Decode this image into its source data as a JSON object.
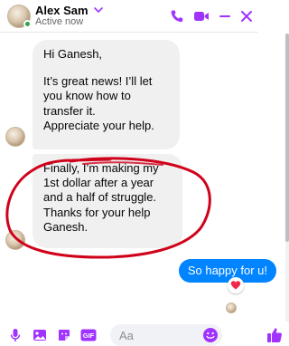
{
  "header": {
    "contact_name": "Alex Sam",
    "status": "Active now",
    "icons": [
      "phone-icon",
      "video-icon",
      "minimize-icon",
      "close-icon"
    ],
    "accent_color": "#a033ff"
  },
  "messages": [
    {
      "direction": "incoming",
      "lines": [
        "Hi Ganesh,",
        "",
        "It’s great news! I’ll let",
        "you know how to",
        "transfer it.",
        "Appreciate your help."
      ]
    },
    {
      "direction": "incoming",
      "lines": [
        "Finally, I’m making my",
        "1st dollar after a year",
        "and a half of struggle.",
        "Thanks for your help",
        "Ganesh."
      ],
      "annotation": "red-circle"
    },
    {
      "direction": "outgoing",
      "text": "So happy for u!",
      "reaction": "heart"
    }
  ],
  "composer": {
    "placeholder": "Aa",
    "tools": [
      "microphone-icon",
      "image-icon",
      "sticker-icon",
      "gif-icon"
    ],
    "like_icon": "thumbs-up-icon"
  },
  "colors": {
    "outgoing_bubble": "#0084ff",
    "incoming_bubble": "#f0f0f0",
    "annotation": "#d0021b",
    "online": "#31a24c"
  }
}
